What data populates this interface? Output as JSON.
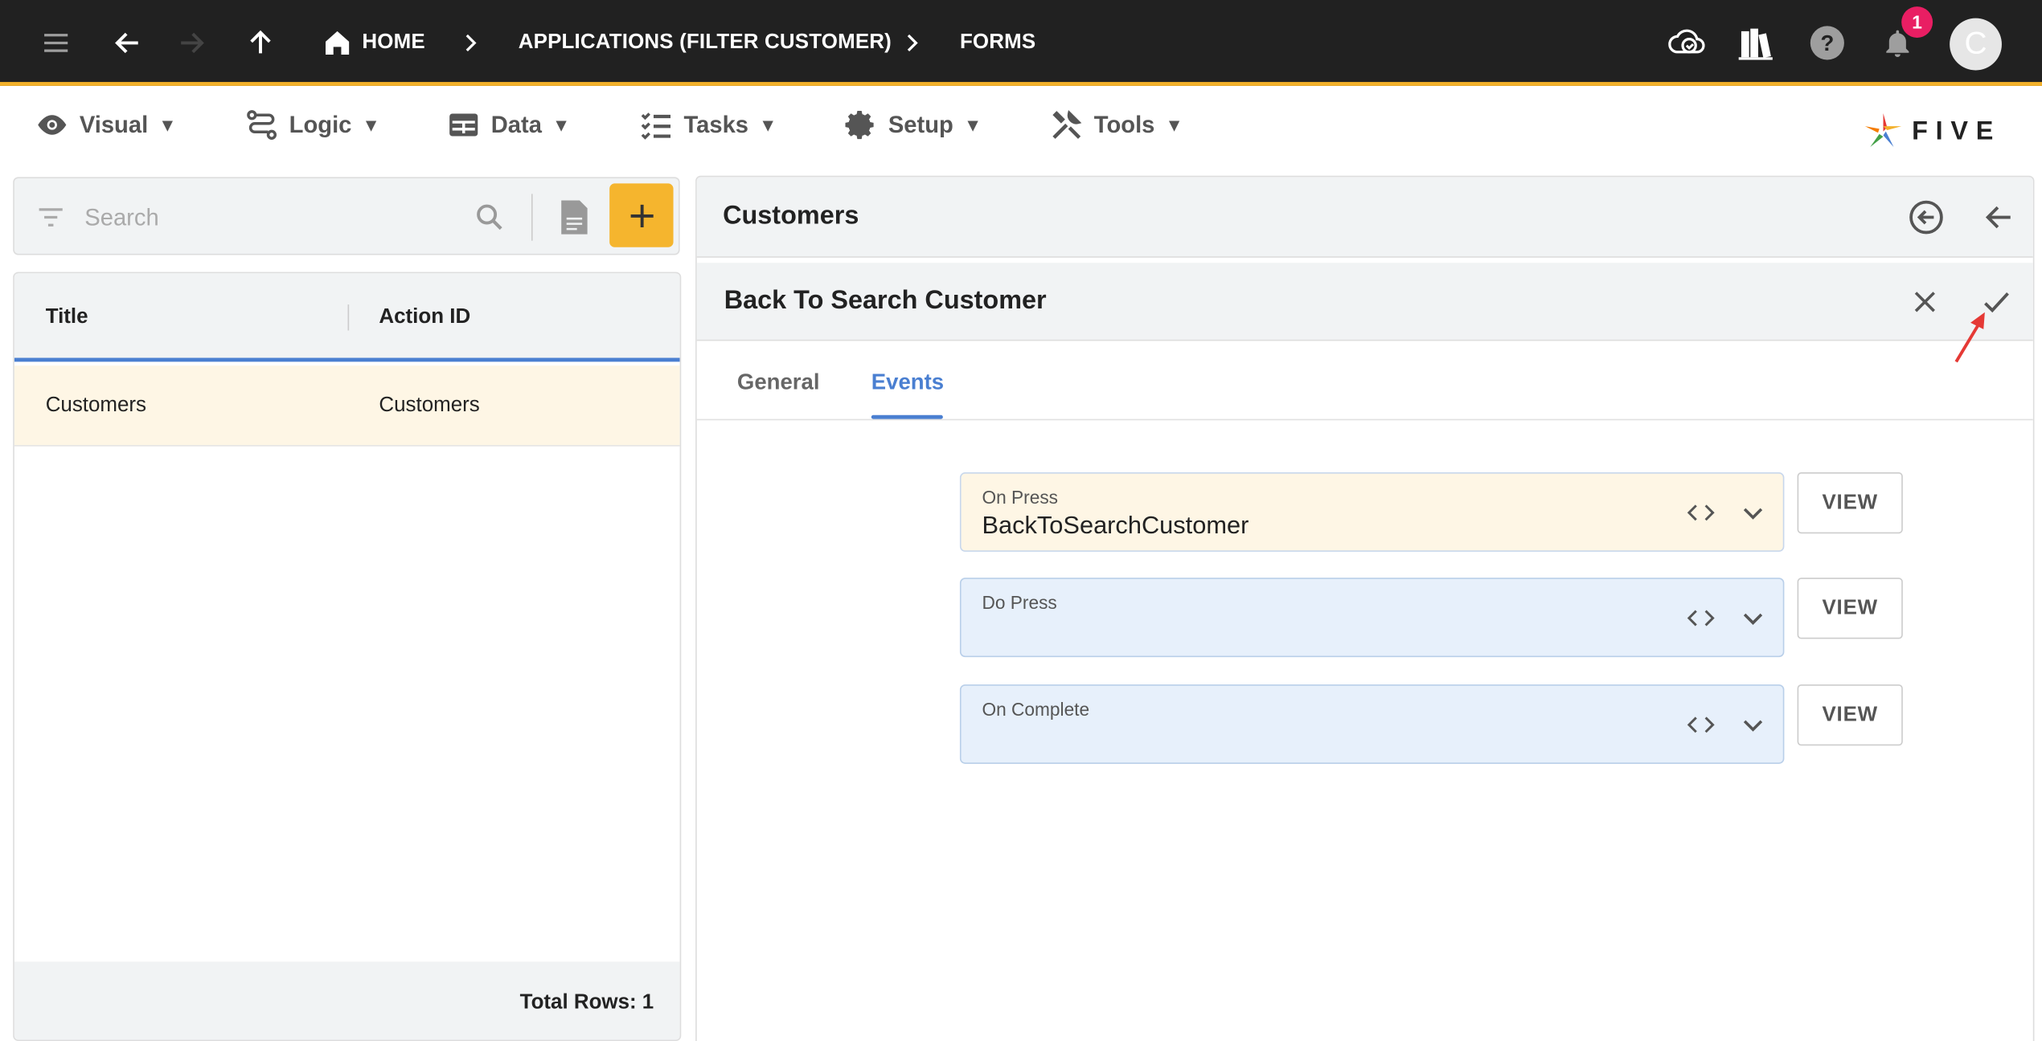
{
  "topbar": {
    "breadcrumbs": [
      "HOME",
      "APPLICATIONS (FILTER CUSTOMER)",
      "FORMS"
    ],
    "notification_count": "1",
    "avatar_initial": "C"
  },
  "menu": {
    "items": [
      {
        "label": "Visual",
        "icon": "eye-icon"
      },
      {
        "label": "Logic",
        "icon": "logic-flow-icon"
      },
      {
        "label": "Data",
        "icon": "table-icon"
      },
      {
        "label": "Tasks",
        "icon": "checklist-icon"
      },
      {
        "label": "Setup",
        "icon": "gear-icon"
      },
      {
        "label": "Tools",
        "icon": "tools-icon"
      }
    ],
    "caret": "▼"
  },
  "logo": {
    "text": "FIVE"
  },
  "left": {
    "search_placeholder": "Search",
    "columns": [
      "Title",
      "Action ID"
    ],
    "rows": [
      {
        "title": "Customers",
        "action_id": "Customers"
      }
    ],
    "footer": "Total Rows: 1"
  },
  "right": {
    "panel_title": "Customers",
    "form_title": "Back To Search Customer",
    "tabs": [
      "General",
      "Events"
    ],
    "active_tab": "Events",
    "fields": [
      {
        "label": "On Press",
        "value": "BackToSearchCustomer"
      },
      {
        "label": "Do Press",
        "value": ""
      },
      {
        "label": "On Complete",
        "value": ""
      }
    ],
    "view_label": "VIEW"
  },
  "colors": {
    "topbar": "#212121",
    "accent": "#F3B12B",
    "tab_active": "#4A7FD1",
    "selected_row": "#FEF6E5",
    "field_empty": "#E7F0FB",
    "badge": "#E91E63",
    "annotation_arrow": "#E53935"
  }
}
